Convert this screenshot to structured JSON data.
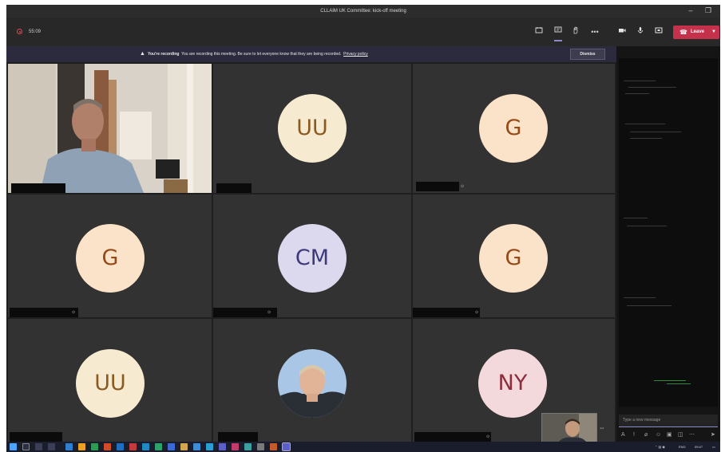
{
  "window": {
    "title": "CLLAIM UK Committee: kick-off meeting",
    "controls": {
      "minimize": "–",
      "restore": "❐"
    }
  },
  "toolbar": {
    "recording_timer": "55:09",
    "leave_label": "Leave",
    "more_label": "•••"
  },
  "banner": {
    "title": "You're recording",
    "message": "You are recording this meeting. Be sure to let everyone know that they are being recorded.",
    "link": "Privacy policy",
    "dismiss": "Dismiss"
  },
  "participants": [
    {
      "type": "video"
    },
    {
      "type": "initials",
      "initials": "UU",
      "bg": "#f6ead1",
      "fg": "#8b5a20"
    },
    {
      "type": "initials",
      "initials": "G",
      "bg": "#fbe3c9",
      "fg": "#944a19"
    },
    {
      "type": "initials",
      "initials": "G",
      "bg": "#fbe3c9",
      "fg": "#944a19"
    },
    {
      "type": "initials",
      "initials": "CM",
      "bg": "#dcd9ef",
      "fg": "#3c3a78"
    },
    {
      "type": "initials",
      "initials": "G",
      "bg": "#fbe3c9",
      "fg": "#944a19"
    },
    {
      "type": "initials",
      "initials": "UU",
      "bg": "#f6ead1",
      "fg": "#8b5a20"
    },
    {
      "type": "photo"
    },
    {
      "type": "initials",
      "initials": "NY",
      "bg": "#f3d8dc",
      "fg": "#8e2e3c"
    }
  ],
  "chat": {
    "placeholder": "Type a new message"
  },
  "taskbar": {
    "language": "ENG",
    "time": "09:47"
  },
  "colors": {
    "accent": "#8b8cc7",
    "leave": "#c4314b",
    "tile": "#333232"
  }
}
